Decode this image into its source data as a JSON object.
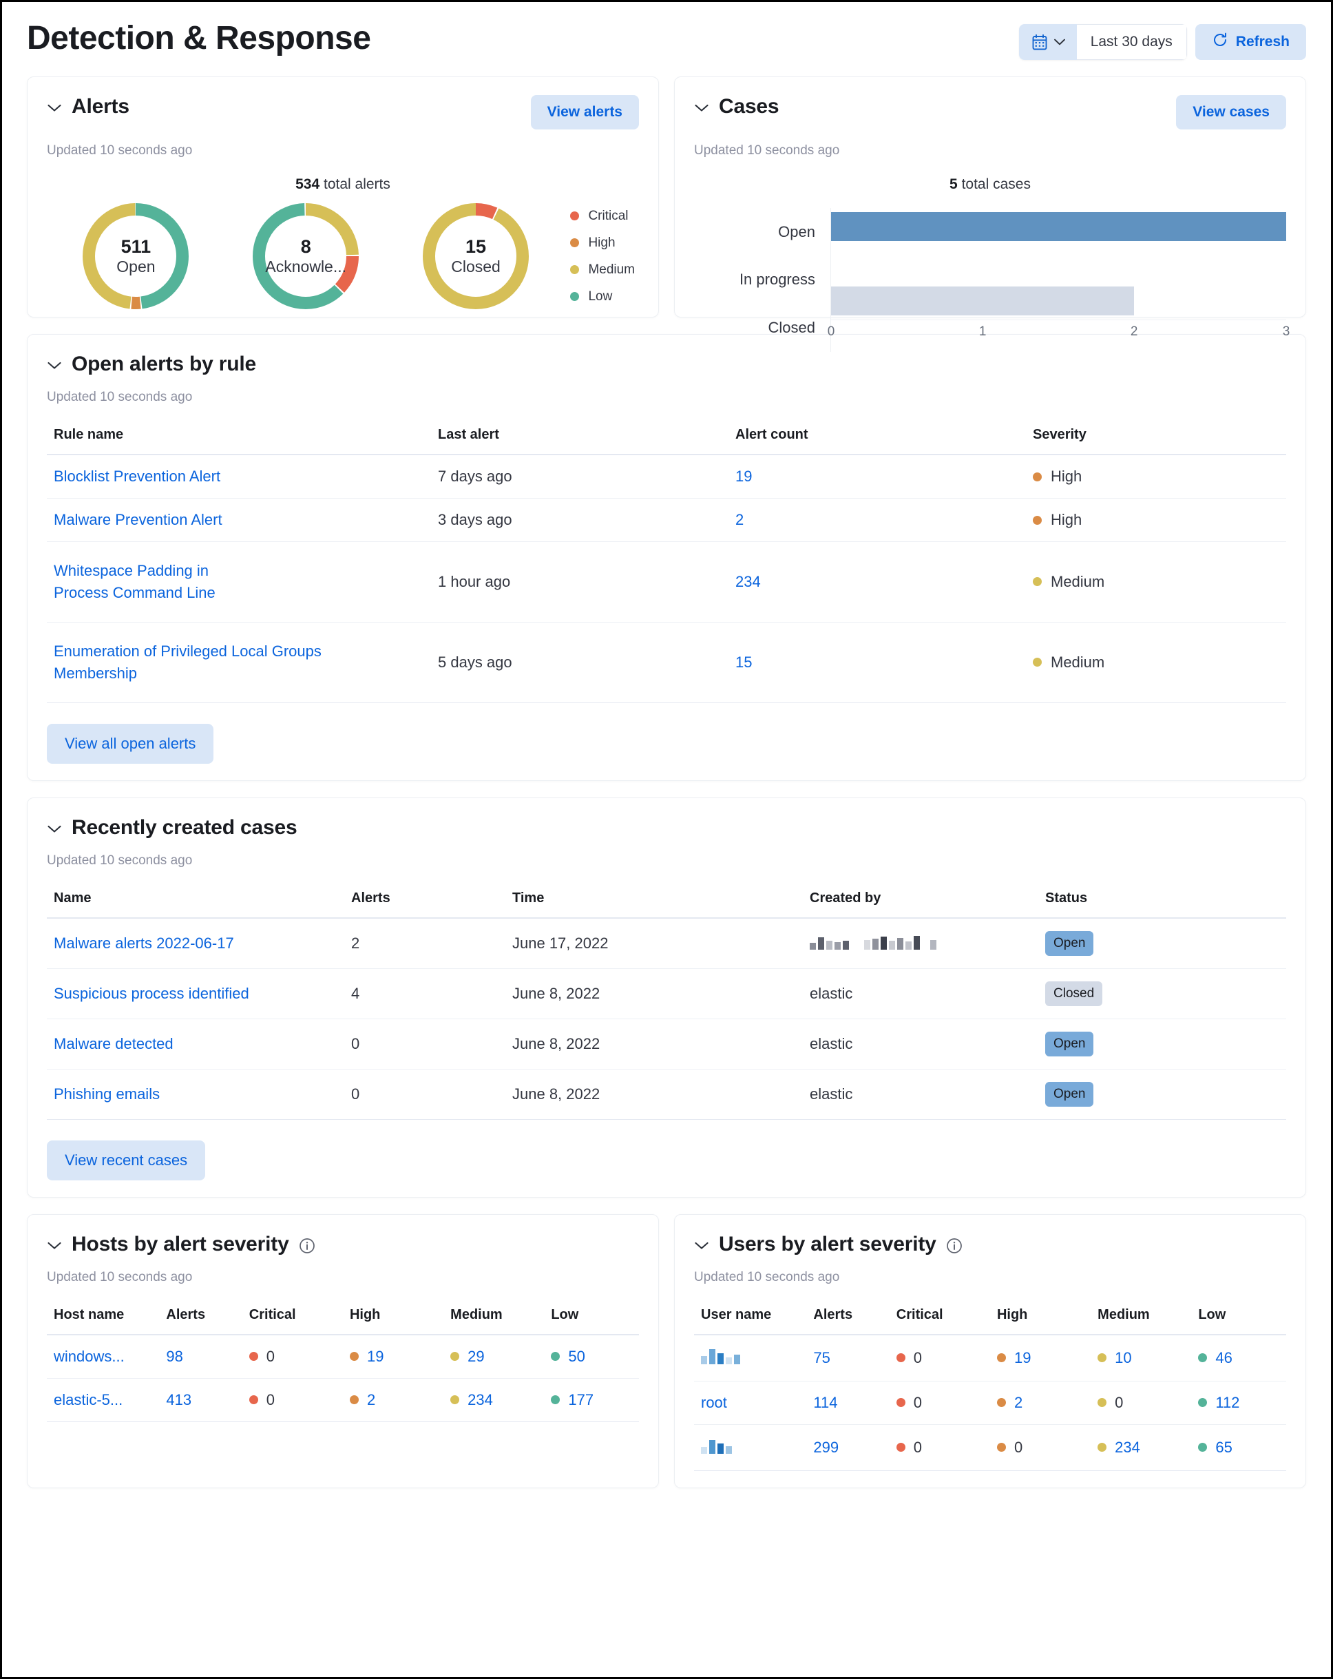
{
  "header": {
    "title": "Detection & Response",
    "calendar_icon": "calendar-icon",
    "chevron_icon": "chevron-down-icon",
    "date_range": "Last 30 days",
    "refresh_icon": "refresh-icon",
    "refresh_label": "Refresh"
  },
  "colors": {
    "critical": "#e7664c",
    "high": "#da8b45",
    "medium": "#d6bf57",
    "low": "#54b399",
    "link": "#0b64dd",
    "bar_open": "#6092c0",
    "bar_closed": "#d3dae6",
    "badge_open": "#79aad9",
    "badge_closed": "#d3dae6"
  },
  "alerts_panel": {
    "title": "Alerts",
    "action_label": "View alerts",
    "updated": "Updated 10 seconds ago",
    "total_value": "534",
    "total_suffix": "total alerts",
    "donuts": [
      {
        "value": "511",
        "caption": "Open"
      },
      {
        "value": "8",
        "caption": "Acknowle..."
      },
      {
        "value": "15",
        "caption": "Closed"
      }
    ],
    "legend": [
      {
        "label": "Critical",
        "color": "#e7664c"
      },
      {
        "label": "High",
        "color": "#da8b45"
      },
      {
        "label": "Medium",
        "color": "#d6bf57"
      },
      {
        "label": "Low",
        "color": "#54b399"
      }
    ]
  },
  "cases_panel": {
    "title": "Cases",
    "action_label": "View cases",
    "updated": "Updated 10 seconds ago",
    "total_value": "5",
    "total_suffix": "total cases"
  },
  "chart_data": [
    {
      "type": "pie",
      "title": "511 Open",
      "labels": [
        "Low",
        "High",
        "Medium"
      ],
      "values": [
        246,
        16,
        249
      ],
      "colors": [
        "#54b399",
        "#da8b45",
        "#d6bf57"
      ],
      "center_value": 511,
      "center_label": "Open",
      "legend": "right"
    },
    {
      "type": "pie",
      "title": "8 Acknowledged",
      "labels": [
        "Medium",
        "Critical",
        "Low"
      ],
      "values": [
        2,
        1,
        5
      ],
      "colors": [
        "#d6bf57",
        "#e7664c",
        "#54b399"
      ],
      "center_value": 8,
      "center_label": "Acknowle...",
      "legend": "right"
    },
    {
      "type": "pie",
      "title": "15 Closed",
      "labels": [
        "Critical",
        "Medium"
      ],
      "values": [
        1,
        14
      ],
      "colors": [
        "#e7664c",
        "#d6bf57"
      ],
      "center_value": 15,
      "center_label": "Closed",
      "legend": "right"
    },
    {
      "type": "bar",
      "orientation": "horizontal",
      "title": "5 total cases",
      "categories": [
        "Open",
        "In progress",
        "Closed"
      ],
      "values": [
        3,
        0,
        2
      ],
      "colors": [
        "#6092c0",
        "#6092c0",
        "#d3dae6"
      ],
      "xlabel": "",
      "ylabel": "",
      "xlim": [
        0,
        3
      ],
      "xticks": [
        "0",
        "1",
        "2",
        "3"
      ],
      "grid": false,
      "legend": "none"
    }
  ],
  "open_alerts_panel": {
    "title": "Open alerts by rule",
    "updated": "Updated 10 seconds ago",
    "columns": [
      "Rule name",
      "Last alert",
      "Alert count",
      "Severity"
    ],
    "rows": [
      {
        "rule": "Blocklist Prevention Alert",
        "last_alert": "7 days ago",
        "count": "19",
        "severity": "High",
        "sev_color": "#da8b45"
      },
      {
        "rule": "Malware Prevention Alert",
        "last_alert": "3 days ago",
        "count": "2",
        "severity": "High",
        "sev_color": "#da8b45"
      },
      {
        "rule": "Whitespace Padding in Process Command Line",
        "last_alert": "1 hour ago",
        "count": "234",
        "severity": "Medium",
        "sev_color": "#d6bf57"
      },
      {
        "rule": "Enumeration of Privileged Local Groups Membership",
        "last_alert": "5 days ago",
        "count": "15",
        "severity": "Medium",
        "sev_color": "#d6bf57"
      }
    ],
    "foot_label": "View all open alerts"
  },
  "recent_cases_panel": {
    "title": "Recently created cases",
    "updated": "Updated 10 seconds ago",
    "columns": [
      "Name",
      "Alerts",
      "Time",
      "Created by",
      "Status"
    ],
    "rows": [
      {
        "name": "Malware alerts 2022-06-17",
        "alerts": "2",
        "time": "June 17, 2022",
        "created_by": "",
        "created_by_redacted": true,
        "status": "Open"
      },
      {
        "name": "Suspicious process identified",
        "alerts": "4",
        "time": "June 8, 2022",
        "created_by": "elastic",
        "created_by_redacted": false,
        "status": "Closed"
      },
      {
        "name": "Malware detected",
        "alerts": "0",
        "time": "June 8, 2022",
        "created_by": "elastic",
        "created_by_redacted": false,
        "status": "Open"
      },
      {
        "name": "Phishing emails",
        "alerts": "0",
        "time": "June 8, 2022",
        "created_by": "elastic",
        "created_by_redacted": false,
        "status": "Open"
      }
    ],
    "foot_label": "View recent cases"
  },
  "hosts_panel": {
    "title": "Hosts by alert severity",
    "info_icon": "info-icon",
    "updated": "Updated 10 seconds ago",
    "columns": [
      "Host name",
      "Alerts",
      "Critical",
      "High",
      "Medium",
      "Low"
    ],
    "rows": [
      {
        "name": "windows...",
        "redacted": false,
        "alerts": "98",
        "critical": "0",
        "high": "19",
        "medium": "29",
        "low": "50"
      },
      {
        "name": "elastic-5...",
        "redacted": false,
        "alerts": "413",
        "critical": "0",
        "high": "2",
        "medium": "234",
        "low": "177"
      }
    ]
  },
  "users_panel": {
    "title": "Users by alert severity",
    "info_icon": "info-icon",
    "updated": "Updated 10 seconds ago",
    "columns": [
      "User name",
      "Alerts",
      "Critical",
      "High",
      "Medium",
      "Low"
    ],
    "rows": [
      {
        "name": "",
        "redacted": true,
        "alerts": "75",
        "critical": "0",
        "high": "19",
        "medium": "10",
        "low": "46"
      },
      {
        "name": "root",
        "redacted": false,
        "alerts": "114",
        "critical": "0",
        "high": "2",
        "medium": "0",
        "low": "112"
      },
      {
        "name": "",
        "redacted": true,
        "alerts": "299",
        "critical": "0",
        "high": "0",
        "medium": "234",
        "low": "65"
      }
    ]
  }
}
